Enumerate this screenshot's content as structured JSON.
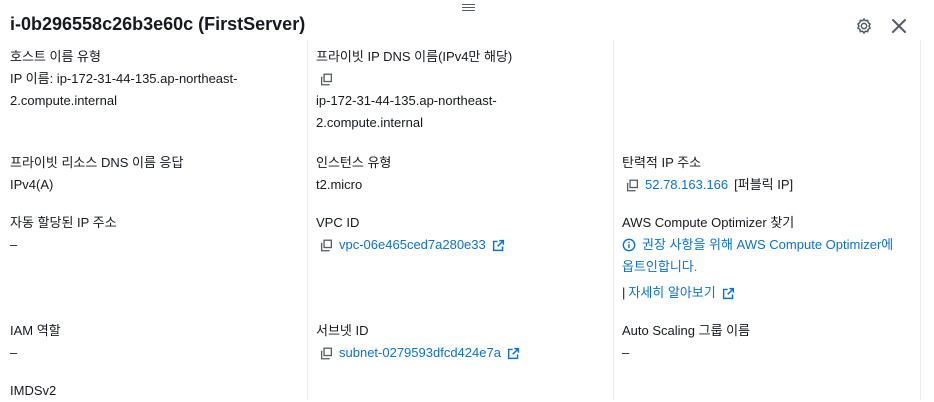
{
  "panel": {
    "title": "i-0b296558c26b3e60c (FirstServer)"
  },
  "col1": {
    "hostname_type_label": "호스트 이름 유형",
    "hostname_type_value_line1": "IP 이름: ip-172-31-44-135.ap-northeast-",
    "hostname_type_value_line2": "2.compute.internal",
    "private_dns_response_label": "프라이빗 리소스 DNS 이름 응답",
    "private_dns_response_value": "IPv4(A)",
    "auto_assigned_ip_label": "자동 할당된 IP 주소",
    "auto_assigned_ip_value": "–",
    "iam_role_label": "IAM 역할",
    "iam_role_value": "–",
    "imdsv2_label": "IMDSv2"
  },
  "col2": {
    "private_ip_dns_label": "프라이빗 IP DNS 이름(IPv4만 해당)",
    "private_ip_dns_line1": "ip-172-31-44-135.ap-northeast-",
    "private_ip_dns_line2": "2.compute.internal",
    "instance_type_label": "인스턴스 유형",
    "instance_type_value": "t2.micro",
    "vpc_id_label": "VPC ID",
    "vpc_id_value": "vpc-06e465ced7a280e33",
    "subnet_id_label": "서브넷 ID",
    "subnet_id_value": "subnet-0279593dfcd424e7a"
  },
  "col3": {
    "elastic_ip_label": "탄력적 IP 주소",
    "elastic_ip_value": "52.78.163.166",
    "elastic_ip_suffix": "[퍼블릭 IP]",
    "optimizer_label": "AWS Compute Optimizer 찾기",
    "optimizer_link_line1": "권장 사항을 위해 AWS Compute Optimizer에",
    "optimizer_link_line2": "옵트인합니다.",
    "learn_more_prefix": "|",
    "learn_more_label": "자세히 알아보기",
    "asg_label": "Auto Scaling 그룹 이름",
    "asg_value": "–"
  },
  "colors": {
    "link": "#0972d3",
    "text": "#16191f",
    "icon": "#545b64"
  },
  "icons": [
    "drag-handle-icon",
    "gear-icon",
    "close-icon",
    "copy-icon",
    "external-link-icon",
    "info-icon"
  ]
}
